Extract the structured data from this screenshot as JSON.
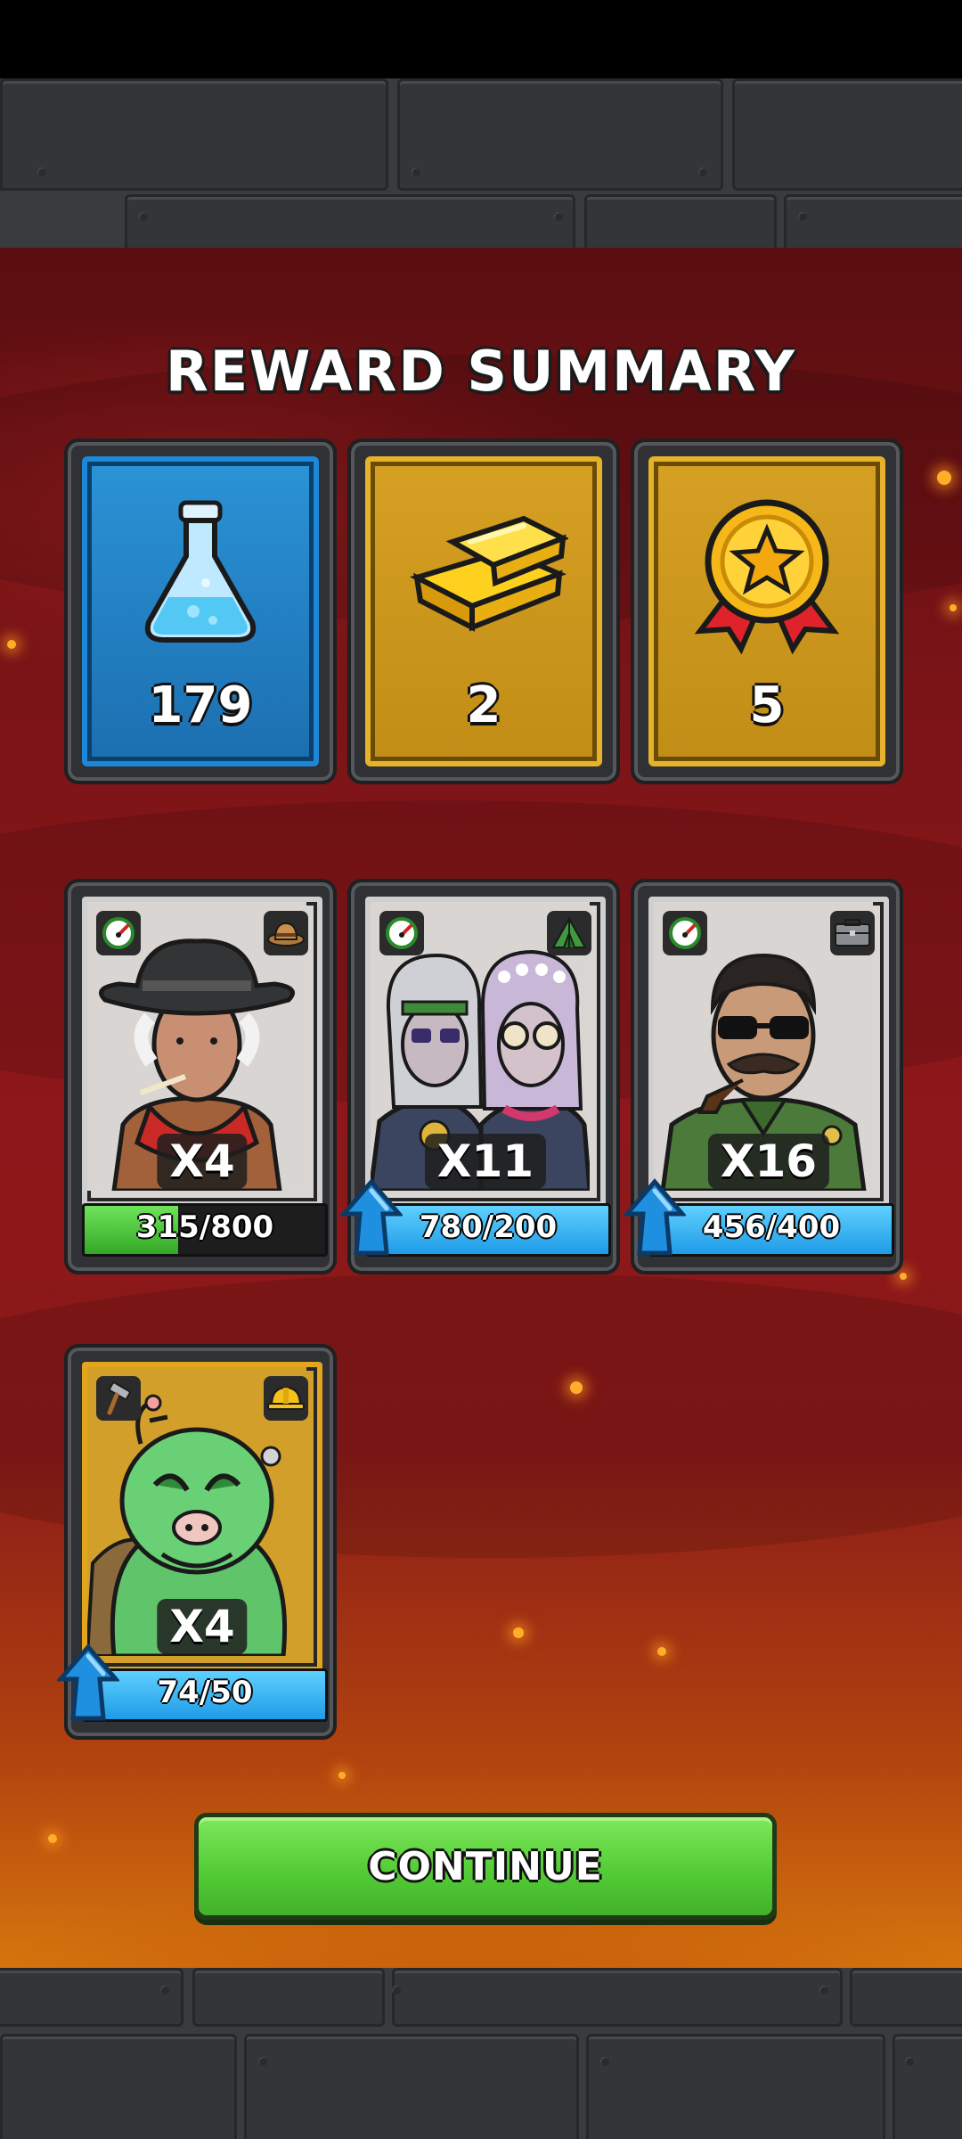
{
  "title": "REWARD SUMMARY",
  "rewards": [
    {
      "icon": "flask-icon",
      "amount": "179",
      "color": "#1d87d8"
    },
    {
      "icon": "gold-bars-icon",
      "amount": "2",
      "color": "#e6b22a"
    },
    {
      "icon": "medal-icon",
      "amount": "5",
      "color": "#e6b22a"
    }
  ],
  "characters": [
    {
      "portrait": "cowboy-portrait",
      "left_icon": "speedometer-icon",
      "right_icon": "hat-icon",
      "multiplier": "X4",
      "progress": "315/800",
      "progress_ratio": 0.39,
      "bar_color": "green",
      "upgrade": false
    },
    {
      "portrait": "hippie-couple-portrait",
      "left_icon": "speedometer-icon",
      "right_icon": "tent-icon",
      "multiplier": "X11",
      "progress": "780/200",
      "progress_ratio": 1.0,
      "bar_color": "blue",
      "upgrade": true
    },
    {
      "portrait": "general-portrait",
      "left_icon": "speedometer-icon",
      "right_icon": "briefcase-icon",
      "multiplier": "X16",
      "progress": "456/400",
      "progress_ratio": 1.0,
      "bar_color": "blue",
      "upgrade": true
    },
    {
      "portrait": "monster-portrait",
      "left_icon": "hammer-icon",
      "right_icon": "hardhat-icon",
      "multiplier": "X4",
      "progress": "74/50",
      "progress_ratio": 1.0,
      "bar_color": "blue",
      "upgrade": true
    }
  ],
  "continue_label": "CONTINUE"
}
